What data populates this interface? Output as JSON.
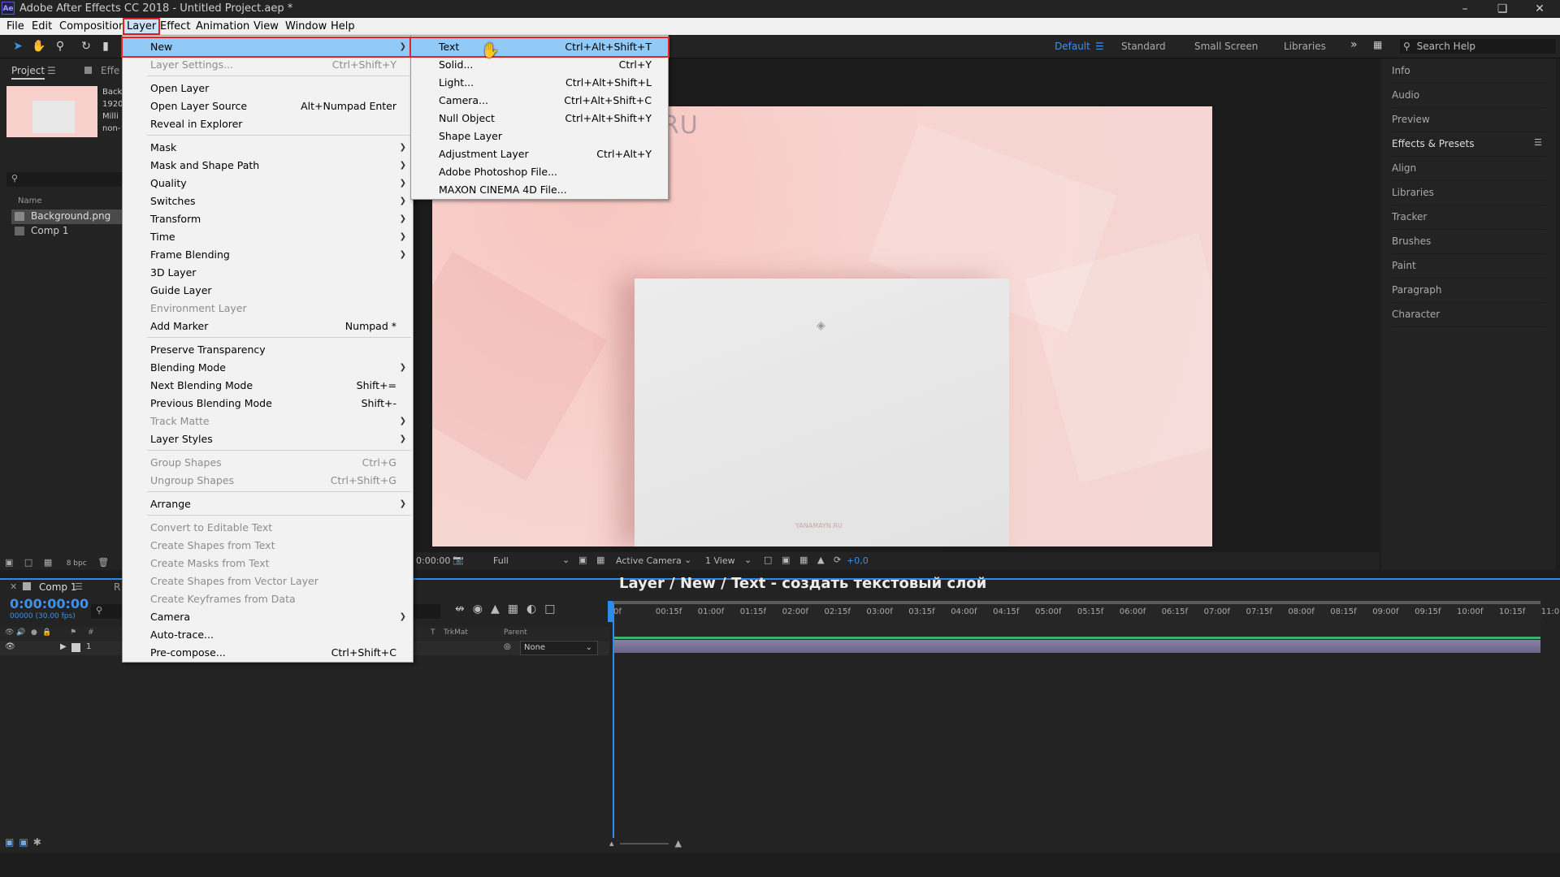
{
  "window": {
    "title": "Adobe After Effects CC 2018 - Untitled Project.aep *",
    "logo": "Ae"
  },
  "menubar": [
    "File",
    "Edit",
    "Composition",
    "Layer",
    "Effect",
    "Animation",
    "View",
    "Window",
    "Help"
  ],
  "workspaces": [
    "Default",
    "Standard",
    "Small Screen",
    "Libraries"
  ],
  "search_help": "Search Help",
  "project_panel": {
    "tab": "Project",
    "tab2": "Effe",
    "thumb_info": [
      "Back",
      "1920",
      "Milli",
      "non-"
    ],
    "col_name": "Name",
    "items": [
      "Background.png",
      "Comp 1"
    ],
    "bpc": "8 bpc"
  },
  "right_panels": [
    "Info",
    "Audio",
    "Preview",
    "Effects & Presets",
    "Align",
    "Libraries",
    "Tracker",
    "Brushes",
    "Paint",
    "Paragraph",
    "Character"
  ],
  "viewer": {
    "watermark": "YANAMAYN.RU",
    "paper_mark": "YANAMAYN.RU",
    "timecode_small": "0:00:00",
    "resolution": "Full",
    "camera": "Active Camera",
    "views": "1 View",
    "exposure": "+0,0"
  },
  "layer_menu": [
    {
      "label": "New",
      "arrow": true,
      "hl": true
    },
    {
      "label": "Layer Settings...",
      "sc": "Ctrl+Shift+Y",
      "dis": true
    },
    {
      "sep": true
    },
    {
      "label": "Open Layer"
    },
    {
      "label": "Open Layer Source",
      "sc": "Alt+Numpad Enter"
    },
    {
      "label": "Reveal in Explorer"
    },
    {
      "sep": true
    },
    {
      "label": "Mask",
      "arrow": true
    },
    {
      "label": "Mask and Shape Path",
      "arrow": true
    },
    {
      "label": "Quality",
      "arrow": true
    },
    {
      "label": "Switches",
      "arrow": true
    },
    {
      "label": "Transform",
      "arrow": true
    },
    {
      "label": "Time",
      "arrow": true
    },
    {
      "label": "Frame Blending",
      "arrow": true
    },
    {
      "label": "3D Layer"
    },
    {
      "label": "Guide Layer"
    },
    {
      "label": "Environment Layer",
      "dis": true
    },
    {
      "label": "Add Marker",
      "sc": "Numpad *"
    },
    {
      "sep": true
    },
    {
      "label": "Preserve Transparency"
    },
    {
      "label": "Blending Mode",
      "arrow": true
    },
    {
      "label": "Next Blending Mode",
      "sc": "Shift+="
    },
    {
      "label": "Previous Blending Mode",
      "sc": "Shift+-"
    },
    {
      "label": "Track Matte",
      "arrow": true,
      "dis": true
    },
    {
      "label": "Layer Styles",
      "arrow": true
    },
    {
      "sep": true
    },
    {
      "label": "Group Shapes",
      "sc": "Ctrl+G",
      "dis": true
    },
    {
      "label": "Ungroup Shapes",
      "sc": "Ctrl+Shift+G",
      "dis": true
    },
    {
      "sep": true
    },
    {
      "label": "Arrange",
      "arrow": true
    },
    {
      "sep": true
    },
    {
      "label": "Convert to Editable Text",
      "dis": true
    },
    {
      "label": "Create Shapes from Text",
      "dis": true
    },
    {
      "label": "Create Masks from Text",
      "dis": true
    },
    {
      "label": "Create Shapes from Vector Layer",
      "dis": true
    },
    {
      "label": "Create Keyframes from Data",
      "dis": true
    },
    {
      "label": "Camera",
      "arrow": true
    },
    {
      "label": "Auto-trace..."
    },
    {
      "label": "Pre-compose...",
      "sc": "Ctrl+Shift+C"
    }
  ],
  "new_menu": [
    {
      "label": "Text",
      "sc": "Ctrl+Alt+Shift+T",
      "hl": true
    },
    {
      "label": "Solid...",
      "sc": "Ctrl+Y"
    },
    {
      "label": "Light...",
      "sc": "Ctrl+Alt+Shift+L"
    },
    {
      "label": "Camera...",
      "sc": "Ctrl+Alt+Shift+C"
    },
    {
      "label": "Null Object",
      "sc": "Ctrl+Alt+Shift+Y"
    },
    {
      "label": "Shape Layer"
    },
    {
      "label": "Adjustment Layer",
      "sc": "Ctrl+Alt+Y"
    },
    {
      "label": "Adobe Photoshop File..."
    },
    {
      "label": "MAXON CINEMA 4D File..."
    }
  ],
  "timeline": {
    "tab": "Comp 1",
    "tab2": "R",
    "timecode": "0:00:00:00",
    "fps": "00000 (30.00 fps)",
    "caption": "Layer / New / Text - создать текстовый слой",
    "col_trkmat": "TrkMat",
    "col_parent": "Parent",
    "col_t": "T",
    "layer_num": "1",
    "parent_value": "None",
    "ruler": [
      "0f",
      "00:15f",
      "01:00f",
      "01:15f",
      "02:00f",
      "02:15f",
      "03:00f",
      "03:15f",
      "04:00f",
      "04:15f",
      "05:00f",
      "05:15f",
      "06:00f",
      "06:15f",
      "07:00f",
      "07:15f",
      "08:00f",
      "08:15f",
      "09:00f",
      "09:15f",
      "10:00f",
      "10:15f",
      "11:0"
    ]
  }
}
